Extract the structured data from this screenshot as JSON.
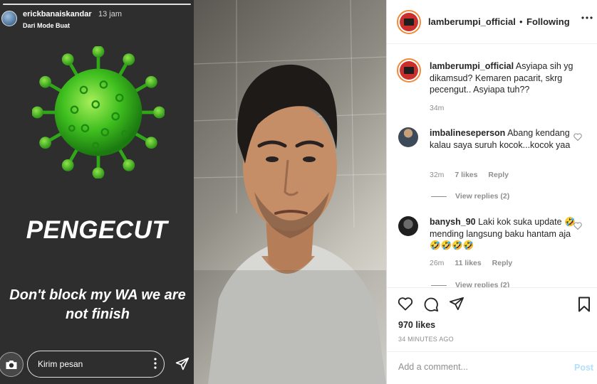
{
  "story": {
    "username": "erickbanaiskandar",
    "time": "13 jam",
    "subtitle": "Dari Mode Buat",
    "headline": "PENGECUT",
    "text": "Don't block my WA we are not finish",
    "reply_placeholder": "Kirim pesan",
    "icons": [
      "camera-icon",
      "more-vertical-icon",
      "send-icon"
    ],
    "virus_color": "#3fbf1f"
  },
  "header": {
    "username": "lamberumpi_official",
    "separator": "•",
    "follow_status": "Following"
  },
  "caption": {
    "username": "lamberumpi_official",
    "text": "Asyiapa sih yg dikamsud? Kemaren pacarit, skrg pecengut.. Asyiapa tuh??",
    "time": "34m"
  },
  "comments": [
    {
      "username": "imbalineseperson",
      "text": "Abang kendang kalau saya suruh kocok...kocok yaa",
      "time": "32m",
      "likes": "7 likes",
      "reply": "Reply",
      "view_replies": "View replies (2)"
    },
    {
      "username": "banysh_90",
      "text": "Laki kok suka update 🤣 mending langsung baku hantam aja 🤣🤣🤣🤣",
      "time": "26m",
      "likes": "11 likes",
      "reply": "Reply",
      "view_replies": "View replies (2)"
    }
  ],
  "actions": {
    "likes": "970 likes",
    "timeago": "34 MINUTES AGO",
    "icons": [
      "heart-icon",
      "comment-icon",
      "share-icon",
      "bookmark-icon"
    ]
  },
  "add_comment": {
    "placeholder": "Add a comment...",
    "post_label": "Post"
  },
  "colors": {
    "story_bg": "#2e2e2e",
    "link_blue_disabled": "#b2dffc",
    "text": "#262626",
    "muted": "#8e8e8e"
  }
}
